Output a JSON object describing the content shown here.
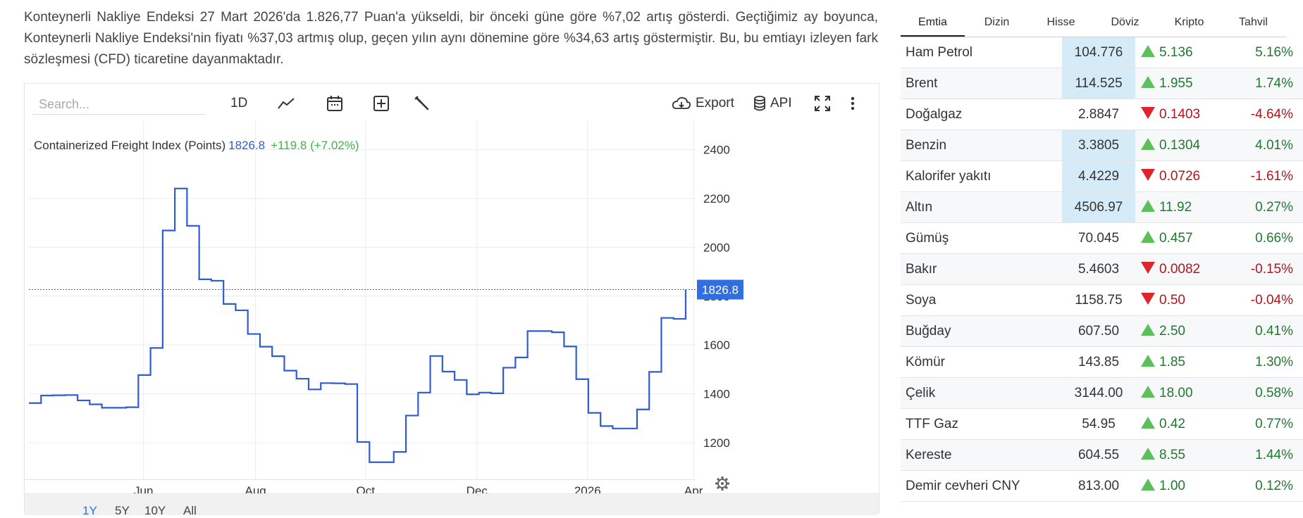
{
  "description": "Konteynerli Nakliye Endeksi 27 Mart 2026'da 1.826,77 Puan'a yükseldi, bir önceki güne göre %7,02 artış gösterdi. Geçtiğimiz ay boyunca, Konteynerli Nakliye Endeksi'nin fiyatı %37,03 artmış olup, geçen yılın aynı dönemine göre %34,63 artış göstermiştir. Bu, bu emtiayı izleyen fark sözleşmesi (CFD) ticaretine dayanmaktadır.",
  "toolbar": {
    "search_placeholder": "Search...",
    "interval_label": "1D",
    "export_label": "Export",
    "api_label": "API"
  },
  "legend": {
    "name": "Containerized Freight Index (Points)",
    "value": "1826.8",
    "change": "+119.8 (+7.02%)"
  },
  "ranges": [
    "1Y",
    "5Y",
    "10Y",
    "All"
  ],
  "active_range": "1Y",
  "colors": {
    "line": "#2f5bd3",
    "last_price_bg": "#2f6fe0",
    "up": "#1f7a2e",
    "down": "#b3141c"
  },
  "chart_data": {
    "type": "line",
    "title": "Containerized Freight Index (Points)",
    "x_tick_labels": [
      "Jun",
      "Aug",
      "Oct",
      "Dec",
      "2026",
      "Apr"
    ],
    "y_tick_labels": [
      "2400",
      "2200",
      "2000",
      "1800",
      "1600",
      "1400",
      "1200"
    ],
    "ylim": [
      1050,
      2520
    ],
    "last_value": 1826.8,
    "last_value_label": "1826.8",
    "grid": true,
    "series": [
      {
        "values": [
          1362,
          1393,
          1394,
          1395,
          1373,
          1357,
          1343,
          1343,
          1345,
          1477,
          1588,
          2069,
          2241,
          2088,
          1869,
          1863,
          1768,
          1742,
          1645,
          1593,
          1554,
          1495,
          1462,
          1418,
          1444,
          1443,
          1440,
          1203,
          1120,
          1120,
          1162,
          1311,
          1405,
          1555,
          1491,
          1457,
          1398,
          1405,
          1402,
          1507,
          1549,
          1657,
          1657,
          1652,
          1594,
          1460,
          1322,
          1268,
          1258,
          1258,
          1336,
          1490,
          1711,
          1707,
          1826.8
        ]
      }
    ]
  },
  "panel": {
    "tabs": [
      "Emtia",
      "Dizin",
      "Hisse",
      "Döviz",
      "Kripto",
      "Tahvil"
    ],
    "active_tab": "Emtia",
    "rows": [
      {
        "name": "Ham Petrol",
        "price": "104.776",
        "change": "5.136",
        "pct": "5.16%",
        "dir": "up",
        "hl": true
      },
      {
        "name": "Brent",
        "price": "114.525",
        "change": "1.955",
        "pct": "1.74%",
        "dir": "up",
        "hl": true
      },
      {
        "name": "Doğalgaz",
        "price": "2.8847",
        "change": "0.1403",
        "pct": "-4.64%",
        "dir": "down",
        "hl": false
      },
      {
        "name": "Benzin",
        "price": "3.3805",
        "change": "0.1304",
        "pct": "4.01%",
        "dir": "up",
        "hl": true
      },
      {
        "name": "Kalorifer yakıtı",
        "price": "4.4229",
        "change": "0.0726",
        "pct": "-1.61%",
        "dir": "down",
        "hl": true
      },
      {
        "name": "Altın",
        "price": "4506.97",
        "change": "11.92",
        "pct": "0.27%",
        "dir": "up",
        "hl": true
      },
      {
        "name": "Gümüş",
        "price": "70.045",
        "change": "0.457",
        "pct": "0.66%",
        "dir": "up",
        "hl": false
      },
      {
        "name": "Bakır",
        "price": "5.4603",
        "change": "0.0082",
        "pct": "-0.15%",
        "dir": "down",
        "hl": false
      },
      {
        "name": "Soya",
        "price": "1158.75",
        "change": "0.50",
        "pct": "-0.04%",
        "dir": "down",
        "hl": false
      },
      {
        "name": "Buğday",
        "price": "607.50",
        "change": "2.50",
        "pct": "0.41%",
        "dir": "up",
        "hl": false
      },
      {
        "name": "Kömür",
        "price": "143.85",
        "change": "1.85",
        "pct": "1.30%",
        "dir": "up",
        "hl": false
      },
      {
        "name": "Çelik",
        "price": "3144.00",
        "change": "18.00",
        "pct": "0.58%",
        "dir": "up",
        "hl": false
      },
      {
        "name": "TTF Gaz",
        "price": "54.95",
        "change": "0.42",
        "pct": "0.77%",
        "dir": "up",
        "hl": false
      },
      {
        "name": "Kereste",
        "price": "604.55",
        "change": "8.55",
        "pct": "1.44%",
        "dir": "up",
        "hl": false
      },
      {
        "name": "Demir cevheri CNY",
        "price": "813.00",
        "change": "1.00",
        "pct": "0.12%",
        "dir": "up",
        "hl": false
      }
    ]
  }
}
